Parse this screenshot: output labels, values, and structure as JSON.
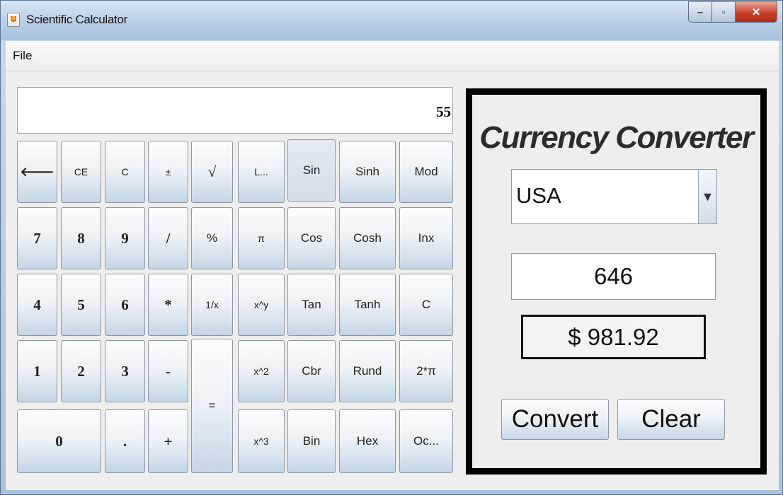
{
  "window": {
    "title": "Scientific Calculator"
  },
  "menu": {
    "file": "File"
  },
  "display": {
    "value": "55"
  },
  "keys": {
    "back": "🡐",
    "ce": "CE",
    "c": "C",
    "plusminus": "±",
    "sqrt": "√",
    "log": "L...",
    "sin": "Sin",
    "sinh": "Sinh",
    "mod": "Mod",
    "k7": "7",
    "k8": "8",
    "k9": "9",
    "div": "/",
    "pct": "%",
    "pi": "π",
    "cos": "Cos",
    "cosh": "Cosh",
    "inx": "Inx",
    "k4": "4",
    "k5": "5",
    "k6": "6",
    "mul": "*",
    "recip": "1/x",
    "xpowy": "x^y",
    "tan": "Tan",
    "tanh": "Tanh",
    "c2": "C",
    "k1": "1",
    "k2": "2",
    "k3": "3",
    "minus": "-",
    "eq": "=",
    "sq": "x^2",
    "cbr": "Cbr",
    "rund": "Rund",
    "twopi": "2*π",
    "k0": "0",
    "dot": ".",
    "plus": "+",
    "cube": "x^3",
    "bin": "Bin",
    "hex": "Hex",
    "oct": "Oc..."
  },
  "converter": {
    "title": "Currency Converter",
    "country": "USA",
    "amount": "646",
    "result": "$ 981.92",
    "convert": "Convert",
    "clear": "Clear"
  }
}
